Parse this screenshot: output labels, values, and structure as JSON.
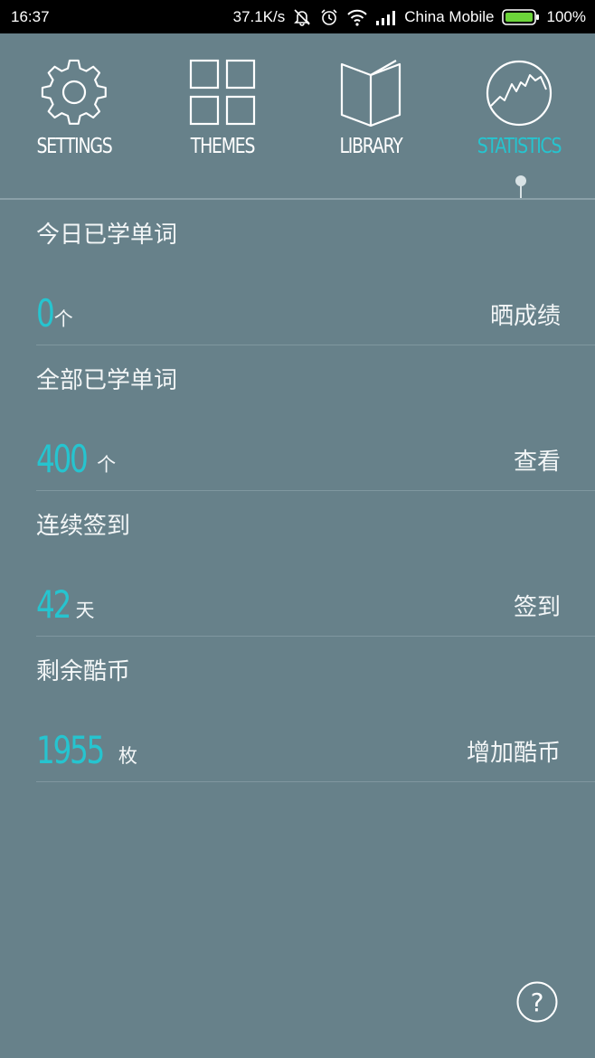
{
  "status_bar": {
    "time": "16:37",
    "speed": "37.1K/s",
    "carrier": "China Mobile",
    "battery": "100%",
    "battery_color": "#6cd43a",
    "icons": [
      "mute-icon",
      "alarm-icon",
      "wifi-icon",
      "signal-icon",
      "battery-icon"
    ]
  },
  "nav": {
    "accent_color": "#26c4cf",
    "items": [
      {
        "label": "SETTINGS",
        "icon": "gear-icon"
      },
      {
        "label": "THEMES",
        "icon": "grid-icon"
      },
      {
        "label": "LIBRARY",
        "icon": "book-icon"
      },
      {
        "label": "STATISTICS",
        "icon": "chart-icon",
        "active": true
      }
    ]
  },
  "stats": [
    {
      "title": "今日已学单词",
      "value": "0",
      "unit": "个",
      "action": "晒成绩"
    },
    {
      "title": "全部已学单词",
      "value": "400",
      "unit": "个",
      "action": "查看"
    },
    {
      "title": "连续签到",
      "value": "42",
      "unit": "天",
      "action": "签到"
    },
    {
      "title": "剩余酷币",
      "value": "1955",
      "unit": "枚",
      "action": "增加酷币"
    }
  ],
  "help": {
    "label": "?",
    "icon": "help-icon"
  }
}
